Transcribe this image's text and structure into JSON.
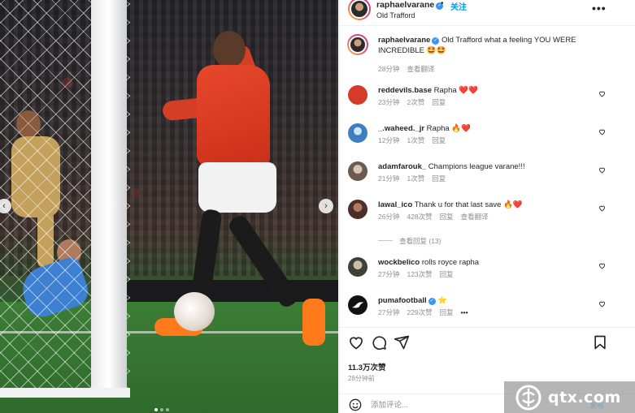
{
  "post": {
    "username": "raphaelvarane",
    "follow_label": "关注",
    "separator": "•",
    "location": "Old Trafford",
    "more_label": "•••",
    "caption_user": "raphaelvarane",
    "caption_text": "Old Trafford what a feeling YOU WERE INCREDIBLE 🤩🤩",
    "caption_time": "28分钟",
    "caption_translate": "查看翻译",
    "likes": "11.3万次赞",
    "posted": "28分钟前"
  },
  "comments": [
    {
      "user": "reddevils.base",
      "text": "Rapha ❤️❤️",
      "time": "23分钟",
      "likes": "2次赞",
      "reply": "回复",
      "extra": "",
      "avatar_color": "#d63a2a"
    },
    {
      "user": "_.waheed._jr",
      "text": "Rapha 🔥❤️",
      "time": "12分钟",
      "likes": "1次赞",
      "reply": "回复",
      "extra": "",
      "avatar_color": "#3f7fbf"
    },
    {
      "user": "adamfarouk_",
      "text": "Champions league varane!!!",
      "time": "21分钟",
      "likes": "1次赞",
      "reply": "回复",
      "extra": "",
      "avatar_color": "#9a8678"
    },
    {
      "user": "lawal_ico",
      "text": "Thank u for that last save 🔥❤️",
      "time": "26分钟",
      "likes": "428次赞",
      "reply": "回复",
      "extra": "查看翻译",
      "avatar_color": "#7a4a3a"
    },
    {
      "user": "wockbelico",
      "text": "rolls royce rapha",
      "time": "27分钟",
      "likes": "123次赞",
      "reply": "回复",
      "extra": "",
      "avatar_color": "#5a5f4a"
    },
    {
      "user": "pumafootball",
      "text": "⭐",
      "time": "27分钟",
      "likes": "229次赞",
      "reply": "回复",
      "extra": "•••",
      "avatar_color": "#111111"
    }
  ],
  "view_replies": "查看回复 (13)",
  "input": {
    "placeholder": "添加评论..."
  },
  "post_button": "发布",
  "carousel": {
    "prev": "‹",
    "next": "›"
  },
  "watermark": "qtx.com",
  "colors": {
    "accent": "#0095f6",
    "verified": "#3897f0",
    "meta": "#8e8e8e"
  },
  "icons": [
    "heart-icon",
    "comment-icon",
    "share-icon",
    "bookmark-icon",
    "emoji-icon",
    "more-icon",
    "verified-icon"
  ]
}
